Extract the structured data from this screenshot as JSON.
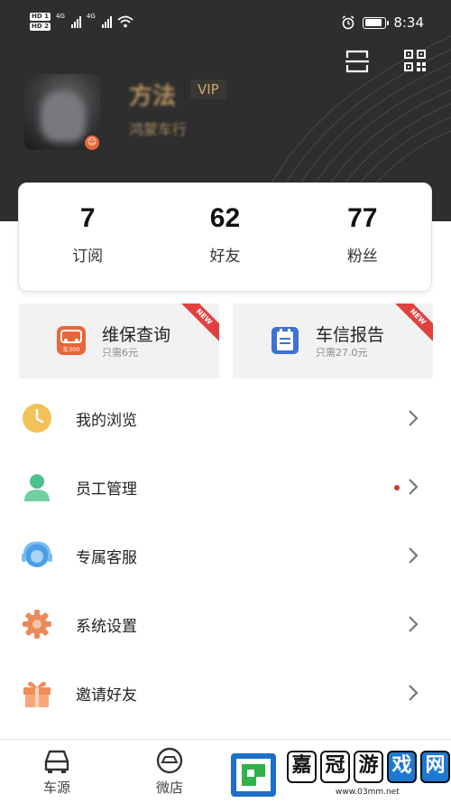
{
  "status_bar": {
    "hd_labels": [
      "HD 1",
      "HD 2"
    ],
    "network_labels": [
      "4G",
      "4G"
    ],
    "time": "8:34",
    "icons": [
      "signal-icon",
      "wifi-icon",
      "alarm-icon",
      "battery-icon"
    ],
    "battery_level": 0.9
  },
  "header": {
    "background_color": "#2f2e2e",
    "actions": [
      "scan-icon",
      "qr-code-icon"
    ]
  },
  "profile": {
    "name": "方法",
    "vip_label": "VIP",
    "shop": "鸿蒙车行",
    "badge_glyph": "☺"
  },
  "stats": [
    {
      "value": "7",
      "label": "订阅"
    },
    {
      "value": "62",
      "label": "好友"
    },
    {
      "value": "77",
      "label": "粉丝"
    }
  ],
  "services": [
    {
      "title": "维保查询",
      "subtitle": "只需6元",
      "ribbon": "NEW",
      "icon": "car-report-icon",
      "icon_color": "#e9653a",
      "icon_text": "车300"
    },
    {
      "title": "车信报告",
      "subtitle": "只需27.0元",
      "ribbon": "NEW",
      "icon": "report-icon",
      "icon_color": "#3d72d6"
    }
  ],
  "menu": [
    {
      "label": "我的浏览",
      "icon": "clock-icon",
      "color": "#f3c157",
      "dot": false
    },
    {
      "label": "员工管理",
      "icon": "person-icon",
      "color": "#4cc08d",
      "dot": true
    },
    {
      "label": "专属客服",
      "icon": "headset-icon",
      "color": "#4a9fe6",
      "dot": false
    },
    {
      "label": "系统设置",
      "icon": "gear-icon",
      "color": "#ea8a5a",
      "dot": false
    },
    {
      "label": "邀请好友",
      "icon": "gift-icon",
      "color": "#f08d5a",
      "dot": false
    }
  ],
  "bottom_nav": [
    {
      "label": "车源",
      "icon": "car-icon"
    },
    {
      "label": "微店",
      "icon": "shop-icon"
    }
  ],
  "watermark": {
    "chars": [
      "嘉",
      "冠",
      "游",
      "戏",
      "网"
    ],
    "url": "www.03mm.net"
  }
}
